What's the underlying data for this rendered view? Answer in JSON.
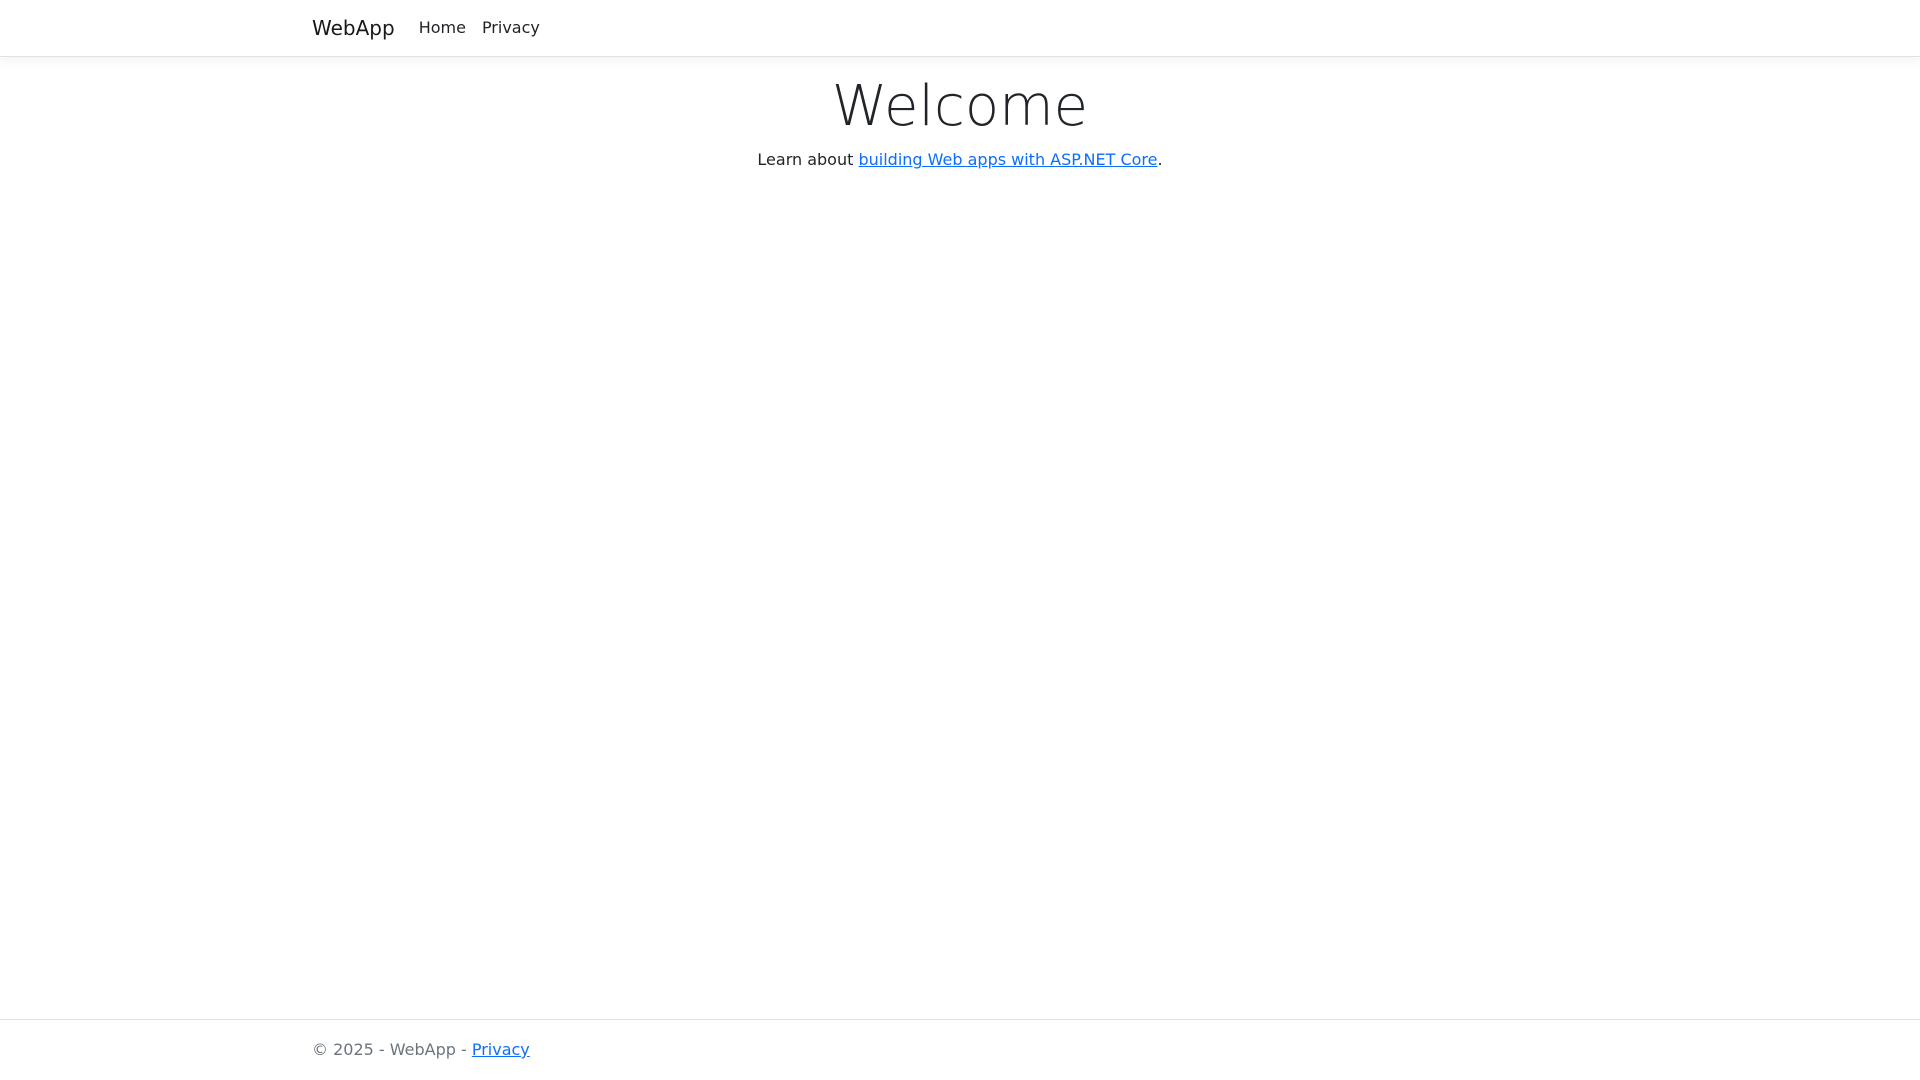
{
  "navbar": {
    "brand": "WebApp",
    "links": [
      {
        "label": "Home"
      },
      {
        "label": "Privacy"
      }
    ]
  },
  "main": {
    "heading": "Welcome",
    "paragraph_prefix": "Learn about ",
    "link_text": "building Web apps with ASP.NET Core",
    "paragraph_suffix": "."
  },
  "footer": {
    "text_prefix": "© 2025 - WebApp - ",
    "link_text": "Privacy"
  },
  "colors": {
    "link": "#0d6efd",
    "text": "#212529",
    "muted": "#6c757d",
    "border": "#dee2e6",
    "background": "#ffffff"
  }
}
